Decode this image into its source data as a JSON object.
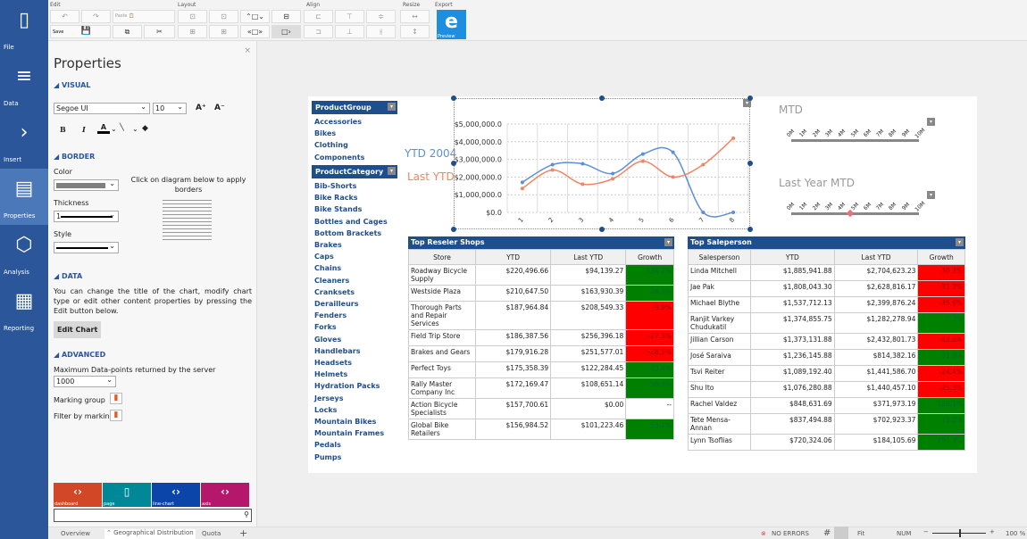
{
  "nav": {
    "items": [
      {
        "label": "File",
        "icon": "file-icon"
      },
      {
        "label": "Data",
        "icon": "database-icon"
      },
      {
        "label": "Insert",
        "icon": "chevron-right-icon"
      },
      {
        "label": "Properties",
        "icon": "properties-icon",
        "selected": true
      },
      {
        "label": "Analysis",
        "icon": "cube-icon"
      },
      {
        "label": "Reporting",
        "icon": "calendar-report-icon"
      }
    ]
  },
  "toolbar": {
    "groups": {
      "edit": "Edit",
      "layout": "Layout",
      "align": "Align",
      "resize": "Resize",
      "export": "Export"
    },
    "paste": "Paste",
    "save": "Save",
    "preview": "Preview"
  },
  "props": {
    "title": "Properties",
    "visual": "VISUAL",
    "font": "Segoe UI",
    "size": "10",
    "border": "BORDER",
    "color_label": "Color",
    "border_color": "#808080",
    "thickness_label": "Thickness",
    "thickness": "1",
    "style_label": "Style",
    "border_hint": "Click on diagram below to apply borders",
    "data": "DATA",
    "data_desc": "You can change the title of the chart, modify chart type or edit other content properties by pressing the Edit button below.",
    "edit_chart": "Edit Chart",
    "advanced": "ADVANCED",
    "max_points_label": "Maximum Data-points returned by the server",
    "max_points": "1000",
    "marking_group": "Marking group",
    "filter_by_marking": "Filter by marking"
  },
  "chips": [
    {
      "label": "dashboard",
      "color": "#d24726"
    },
    {
      "label": "page",
      "color": "#008899"
    },
    {
      "label": "line-chart",
      "color": "#0b45a8"
    },
    {
      "label": "axis",
      "color": "#b5176b"
    }
  ],
  "search": {
    "value": ""
  },
  "tabs": [
    "Overview",
    "Geographical Distribution",
    "Quota"
  ],
  "status": {
    "errors": "NO ERRORS",
    "fit": "Fit",
    "num": "NUM",
    "zoom": "100 %"
  },
  "product_group": {
    "title": "ProductGroup",
    "items": [
      "Accessories",
      "Bikes",
      "Clothing",
      "Components"
    ]
  },
  "product_category": {
    "title": "ProductCategory",
    "items": [
      "Bib-Shorts",
      "Bike Racks",
      "Bike Stands",
      "Bottles and Cages",
      "Bottom Brackets",
      "Brakes",
      "Caps",
      "Chains",
      "Cleaners",
      "Cranksets",
      "Derailleurs",
      "Fenders",
      "Forks",
      "Gloves",
      "Handlebars",
      "Headsets",
      "Helmets",
      "Hydration Packs",
      "Jerseys",
      "Locks",
      "Mountain Bikes",
      "Mountain Frames",
      "Pedals",
      "Pumps"
    ]
  },
  "chart_data": {
    "type": "line",
    "categories": [
      "1",
      "2",
      "3",
      "4",
      "5",
      "6",
      "7",
      "8"
    ],
    "ylim": [
      0,
      5000000
    ],
    "yticks": [
      "$0.0",
      "$1,000,000.0",
      "$2,000,000.0",
      "$3,000,000.0",
      "$4,000,000.0",
      "$5,000,000.0"
    ],
    "grid": true,
    "legend_placement": "left",
    "series": [
      {
        "name": "YTD 2004",
        "color": "#5b8fd9",
        "values": [
          1700000,
          2700000,
          2750000,
          2200000,
          3300000,
          3400000,
          0,
          0
        ]
      },
      {
        "name": "Last YTD",
        "color": "#f4845f",
        "values": [
          1350000,
          2400000,
          1600000,
          1900000,
          2900000,
          2000000,
          2700000,
          4200000
        ]
      }
    ]
  },
  "gauges": [
    {
      "title": "MTD",
      "ticks": [
        "0M",
        "1M",
        "2M",
        "3M",
        "4M",
        "5M",
        "6M",
        "7M",
        "8M",
        "9M",
        "10M"
      ]
    },
    {
      "title": "Last Year MTD",
      "ticks": [
        "0M",
        "1M",
        "2M",
        "3M",
        "4M",
        "5M",
        "6M",
        "7M",
        "8M",
        "9M",
        "10M"
      ],
      "value_m": 4.6,
      "marker_color": "#e8707a"
    }
  ],
  "resellers": {
    "title": "Top Reseler Shops",
    "columns": [
      "Store",
      "YTD",
      "Last YTD",
      "Growth"
    ],
    "rows": [
      [
        "Roadway Bicycle Supply",
        "$220,496.66",
        "$94,139.27",
        "134.2%",
        "g"
      ],
      [
        "Westside Plaza",
        "$210,647.50",
        "$163,930.39",
        "28.5%",
        "g"
      ],
      [
        "Thorough Parts and Repair Services",
        "$187,964.84",
        "$208,549.33",
        "-9.9%",
        "r"
      ],
      [
        "Field Trip Store",
        "$186,387.56",
        "$256,396.18",
        "-27.3%",
        "r"
      ],
      [
        "Brakes and Gears",
        "$179,916.28",
        "$251,577.01",
        "-28.5%",
        "r"
      ],
      [
        "Perfect Toys",
        "$175,358.39",
        "$122,284.45",
        "43.4%",
        "g"
      ],
      [
        "Rally Master Company Inc",
        "$172,169.47",
        "$108,651.14",
        "58.5%",
        "g"
      ],
      [
        "Action Bicycle Specialists",
        "$157,700.61",
        "$0.00",
        "--",
        ""
      ],
      [
        "Global Bike Retailers",
        "$156,984.52",
        "$101,223.46",
        "55.1%",
        "g"
      ]
    ]
  },
  "salespeople": {
    "title": "Top Saleperson",
    "columns": [
      "Salesperson",
      "YTD",
      "Last YTD",
      "Growth"
    ],
    "rows": [
      [
        "Linda Mitchell",
        "$1,885,941.88",
        "$2,704,623.23",
        "-30.3%",
        "r"
      ],
      [
        "Jae Pak",
        "$1,808,043.30",
        "$2,628,816.17",
        "-31.2%",
        "r"
      ],
      [
        "Michael Blythe",
        "$1,537,712.13",
        "$2,399,876.24",
        "-35.9%",
        "r"
      ],
      [
        "Ranjit Varkey Chudukatil",
        "$1,374,855.75",
        "$1,282,278.94",
        "7.2%",
        "g"
      ],
      [
        "Jillian Carson",
        "$1,373,131.88",
        "$2,432,801.73",
        "-43.6%",
        "r"
      ],
      [
        "José Saraiva",
        "$1,236,145.88",
        "$814,382.16",
        "51.8%",
        "g"
      ],
      [
        "Tsvi Reiter",
        "$1,089,192.40",
        "$1,441,586.70",
        "-24.4%",
        "r"
      ],
      [
        "Shu Ito",
        "$1,076,280.88",
        "$1,440,457.10",
        "-25.3%",
        "r"
      ],
      [
        "Rachel Valdez",
        "$848,631.69",
        "$371,973.19",
        "128.1%",
        "g"
      ],
      [
        "Tete Mensa-Annan",
        "$837,494.88",
        "$702,923.37",
        "19.1%",
        "g"
      ],
      [
        "Lynn Tsoflias",
        "$720,324.06",
        "$184,105.69",
        "291.3%",
        "g"
      ]
    ]
  },
  "status_colors": {
    "g": "#008000",
    "r": "#ff0000"
  }
}
